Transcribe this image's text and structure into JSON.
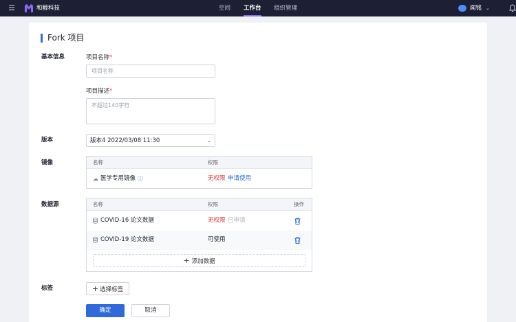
{
  "topbar": {
    "brand": "和鲸科技",
    "nav": [
      "空间",
      "工作台",
      "组织管理"
    ],
    "active_nav": "工作台",
    "user": "闻铭",
    "menu_icon": "hamburger-icon",
    "bell_icon": "bell-icon"
  },
  "page": {
    "title": "Fork 项目"
  },
  "basic": {
    "section_label": "基本信息",
    "name_label": "项目名称",
    "name_placeholder": "项目名称",
    "desc_label": "项目描述",
    "desc_placeholder": "不超过140字符",
    "required_mark": "*"
  },
  "version": {
    "section_label": "版本",
    "selected": "版本4 2022/03/08 11:30"
  },
  "image": {
    "section_label": "镜像",
    "columns": [
      "名称",
      "权限"
    ],
    "rows": [
      {
        "name": "医学专用镜像",
        "permission": "无权限",
        "action": "申请使用"
      }
    ]
  },
  "datasource": {
    "section_label": "数据源",
    "columns": [
      "名称",
      "权限",
      "操作"
    ],
    "rows": [
      {
        "name": "COVID-16 论文数据",
        "permission": "无权限",
        "status": "已申请"
      },
      {
        "name": "COVID-19 论文数据",
        "permission": "可使用",
        "status": ""
      }
    ],
    "add_label": "添加数据"
  },
  "tags": {
    "section_label": "标签",
    "button_label": "选择标签"
  },
  "footer": {
    "confirm": "确定",
    "cancel": "取消"
  },
  "colors": {
    "topbar_bg": "#1d1f35",
    "accent": "#2e6ad9",
    "nav_indicator": "#8b6cf3",
    "danger": "#d63b3b"
  }
}
